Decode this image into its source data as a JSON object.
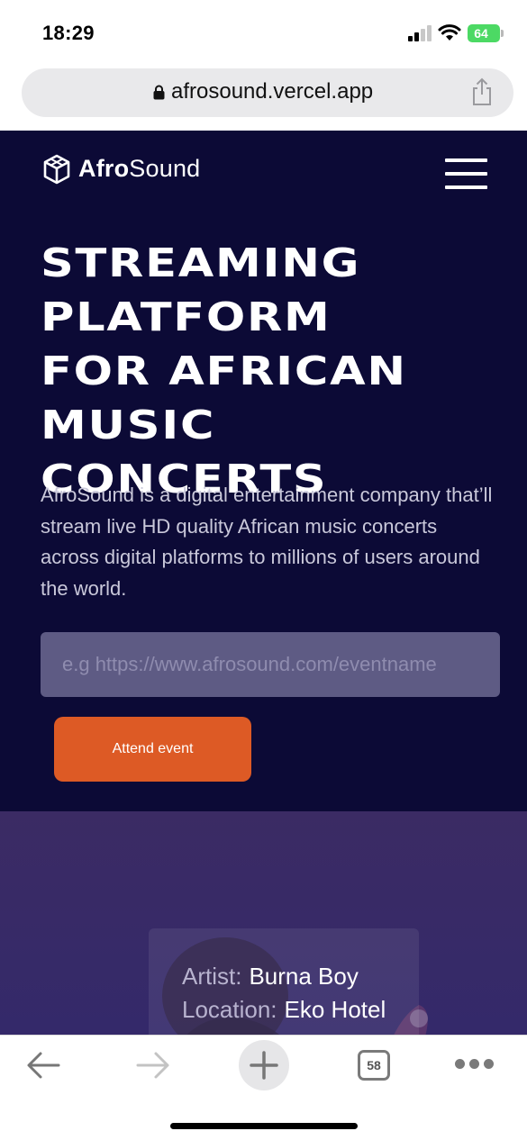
{
  "status_bar": {
    "time": "18:29",
    "battery": "64",
    "icons": [
      "signal-icon",
      "wifi-icon",
      "battery-icon"
    ]
  },
  "browser": {
    "url": "afrosound.vercel.app",
    "tab_count": "58",
    "icons": [
      "lock-icon",
      "share-icon",
      "back-arrow-icon",
      "forward-arrow-icon",
      "plus-icon",
      "tabs-icon",
      "more-icon"
    ]
  },
  "site": {
    "logo_bold": "Afro",
    "logo_light": "Sound",
    "logo_icon": "cube-icon",
    "menu_icon": "hamburger-menu-icon"
  },
  "hero": {
    "title_lines": [
      "STREAMING",
      "PLATFORM",
      "FOR AFRICAN",
      "MUSIC",
      "CONCERTS"
    ],
    "description": "AfroSound is a digital entertainment company that’ll stream live HD quality African music concerts across digital platforms to millions of users around the world.",
    "input_placeholder": "e.g https://www.afrosound.com/eventname",
    "button_label": "Attend event"
  },
  "event_card": {
    "artist_label": "Artist:",
    "artist_value": "Burna Boy",
    "location_label": "Location:",
    "location_value": "Eko Hotel"
  },
  "colors": {
    "hero_bg": "#0c0a36",
    "accent": "#dd5a25",
    "input_bg": "#5e5b84",
    "event_bg": "#3b2b64",
    "battery": "#4cd964"
  }
}
